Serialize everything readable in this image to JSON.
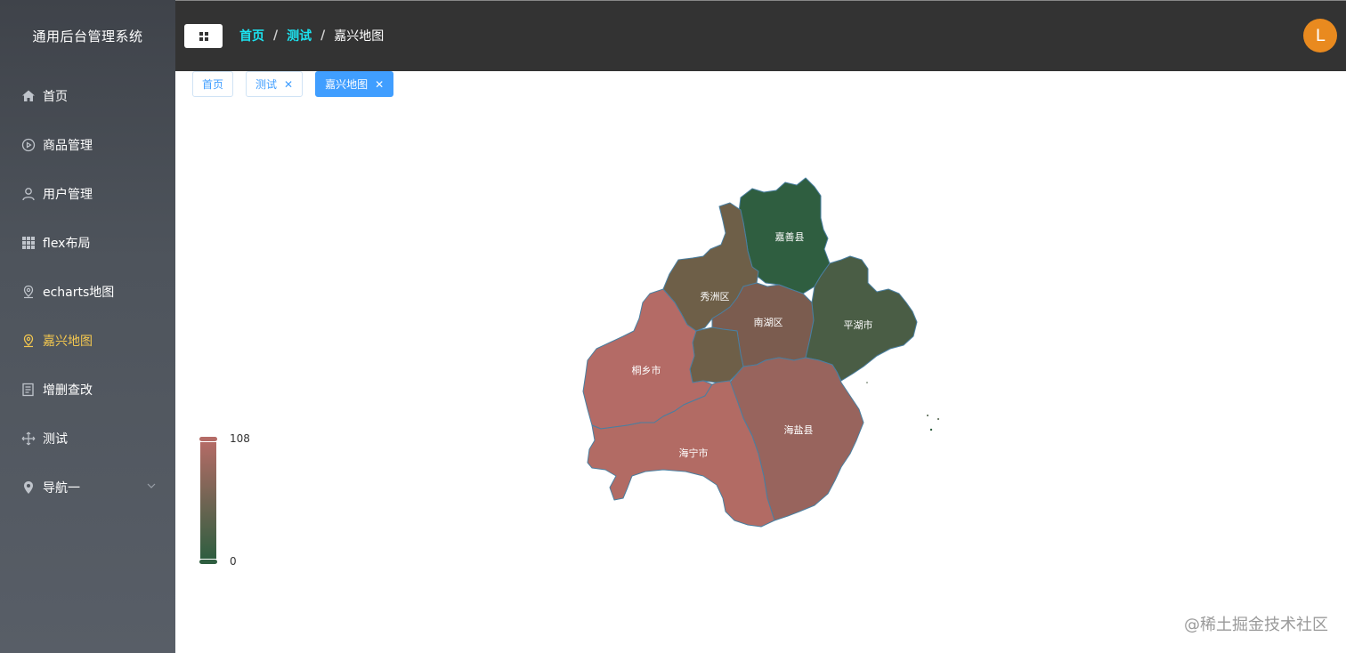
{
  "sidebar": {
    "title": "通用后台管理系统",
    "items": [
      {
        "label": "首页",
        "icon": "home-icon"
      },
      {
        "label": "商品管理",
        "icon": "play-circle-icon"
      },
      {
        "label": "用户管理",
        "icon": "user-icon"
      },
      {
        "label": "flex布局",
        "icon": "grid-icon"
      },
      {
        "label": "echarts地图",
        "icon": "map-pin-outline-icon"
      },
      {
        "label": "嘉兴地图",
        "icon": "map-pin-outline-icon",
        "active": true
      },
      {
        "label": "增删查改",
        "icon": "document-icon"
      },
      {
        "label": "测试",
        "icon": "move-icon"
      },
      {
        "label": "导航一",
        "icon": "location-icon"
      }
    ]
  },
  "header": {
    "breadcrumb": [
      "首页",
      "测试",
      "嘉兴地图"
    ],
    "separator": "/",
    "avatar_letter": "L"
  },
  "tags": [
    {
      "label": "首页",
      "closable": false
    },
    {
      "label": "测试",
      "closable": true
    },
    {
      "label": "嘉兴地图",
      "closable": true,
      "active": true
    }
  ],
  "map": {
    "regions": [
      {
        "name": "嘉善县",
        "color": "#2f5e40"
      },
      {
        "name": "秀洲区",
        "color": "#6e5f48"
      },
      {
        "name": "南湖区",
        "color": "#7b5c4f"
      },
      {
        "name": "平湖市",
        "color": "#4a5d45"
      },
      {
        "name": "桐乡市",
        "color": "#b46b66"
      },
      {
        "name": "海盐县",
        "color": "#98645d"
      },
      {
        "name": "海宁市",
        "color": "#b26b64"
      }
    ],
    "visual_map": {
      "max": "108",
      "min": "0",
      "color_high": "#b46b66",
      "color_low": "#2f5e40"
    }
  },
  "watermark": "@稀土掘金技术社区",
  "colors": {
    "accent": "#409eff",
    "active_menu": "#f3c74f",
    "breadcrumb_link": "#1ce3f0"
  }
}
